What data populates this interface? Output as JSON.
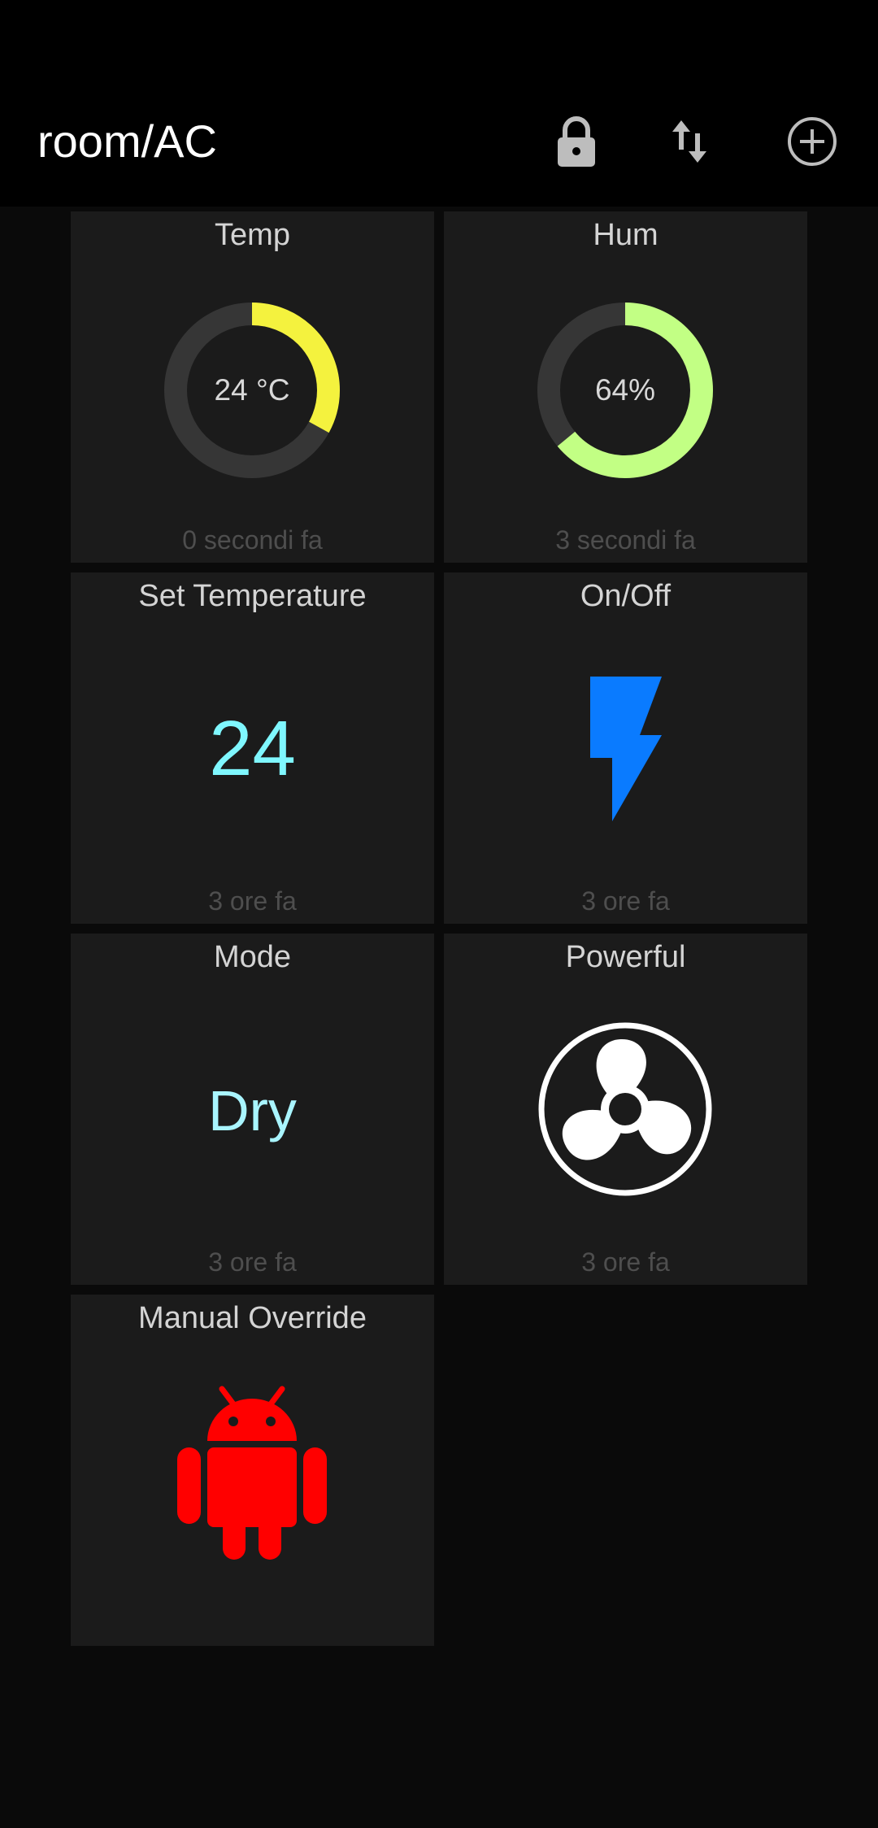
{
  "app": {
    "title": "room/AC"
  },
  "toolbar": {
    "icons": [
      "lock-icon",
      "sort-arrows-icon",
      "add-circle-icon"
    ]
  },
  "tiles": [
    {
      "title": "Temp",
      "display": "24 °C",
      "value": 24,
      "gauge_fraction": 0.33,
      "color": "#f4f23e",
      "time": "0 secondi fa"
    },
    {
      "title": "Hum",
      "display": "64%",
      "value": 64,
      "gauge_fraction": 0.64,
      "color": "#c2ff84",
      "time": "3 secondi fa"
    },
    {
      "title": "Set Temperature",
      "value": "24",
      "color": "#7ff7ff",
      "time": "3 ore fa"
    },
    {
      "title": "On/Off",
      "icon": "lightning-bolt-icon",
      "color": "#0a7bff",
      "time": "3 ore fa"
    },
    {
      "title": "Mode",
      "value": "Dry",
      "color": "#a9f5ff",
      "time": "3 ore fa"
    },
    {
      "title": "Powerful",
      "icon": "fan-icon",
      "color": "#ffffff",
      "time": "3 ore fa"
    },
    {
      "title": "Manual Override",
      "icon": "android-icon",
      "color": "#ff0000",
      "time": ""
    }
  ],
  "colors": {
    "appbar_bg": "#000000",
    "page_bg": "#0a0a0a",
    "tile_bg": "#1b1b1b",
    "gauge_track": "#363636"
  }
}
